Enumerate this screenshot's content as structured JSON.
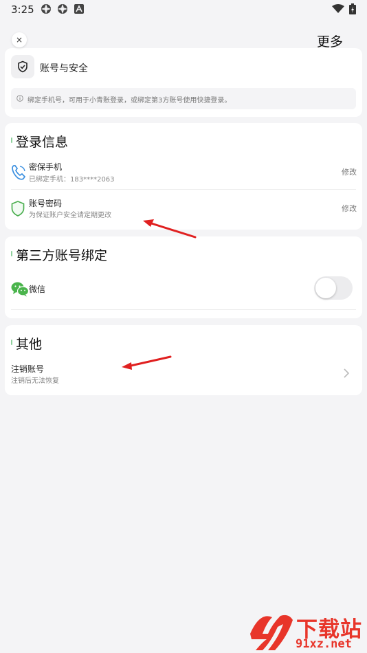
{
  "status_bar": {
    "time": "3:25",
    "icons": [
      "settings-gear-icon",
      "settings-gear-icon",
      "app-a-icon"
    ],
    "right_icons": [
      "wifi-icon",
      "battery-charging-icon"
    ]
  },
  "header": {
    "close_label": "×",
    "more_label": "更多"
  },
  "account_card": {
    "title": "账号与安全",
    "notice": "绑定手机号，可用于小青账登录，或绑定第3方账号使用快捷登录。"
  },
  "login_section": {
    "title": "登录信息",
    "items": [
      {
        "title": "密保手机",
        "subtitle": "已绑定手机：183****2063",
        "action": "修改",
        "icon": "phone-icon"
      },
      {
        "title": "账号密码",
        "subtitle": "为保证账户安全请定期更改",
        "action": "修改",
        "icon": "shield-icon"
      }
    ]
  },
  "third_party_section": {
    "title": "第三方账号绑定",
    "items": [
      {
        "title": "微信",
        "icon": "wechat-icon",
        "bound": false
      }
    ]
  },
  "other_section": {
    "title": "其他",
    "items": [
      {
        "title": "注销账号",
        "subtitle": "注销后无法恢复",
        "icon": "chevron-right-icon"
      }
    ]
  },
  "watermark": {
    "logo_text": "下载站",
    "url": "91xz.net"
  },
  "colors": {
    "background": "#f4f4f6",
    "card": "#ffffff",
    "accent_green": "#4caf50",
    "phone_blue": "#3a8fe0",
    "wechat_green": "#4ab44c",
    "arrow_red": "#e02020",
    "watermark_red": "#e8352a"
  }
}
